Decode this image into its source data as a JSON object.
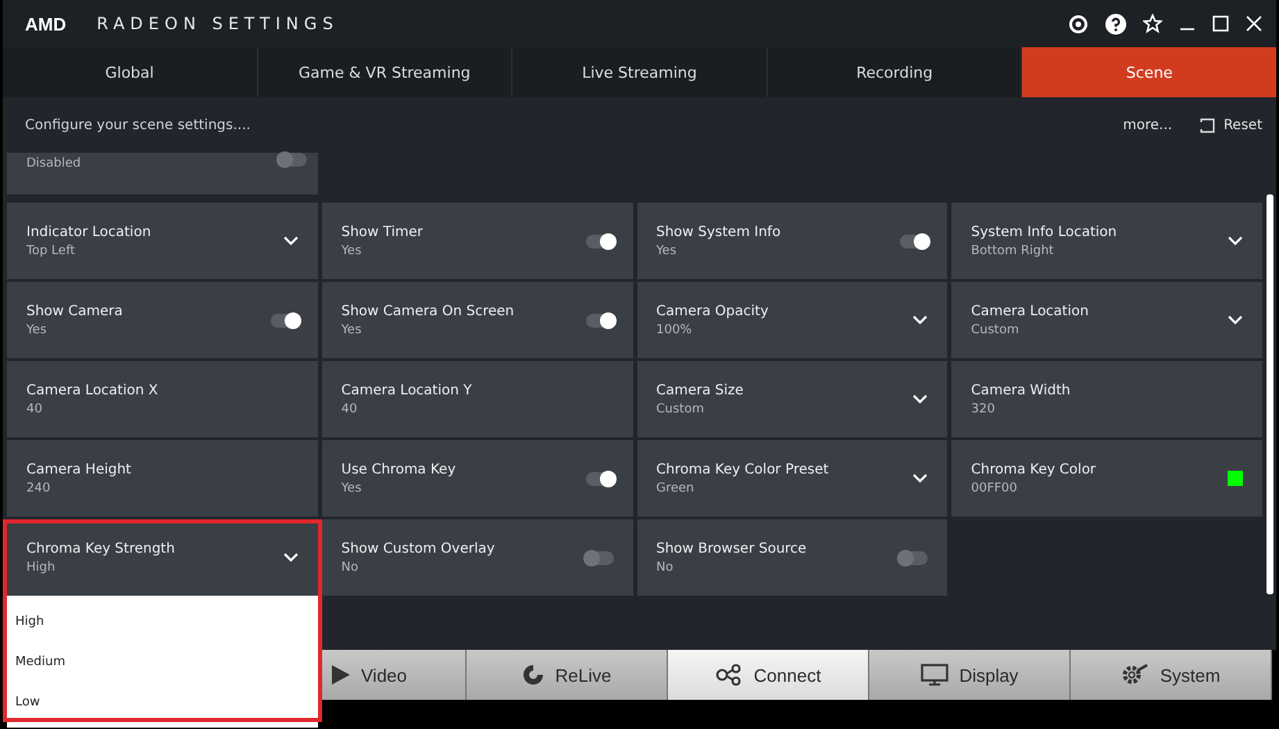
{
  "window": {
    "logo": "AMD",
    "title": "RADEON SETTINGS"
  },
  "tabs": [
    {
      "label": "Global",
      "selected": false
    },
    {
      "label": "Game & VR Streaming",
      "selected": false
    },
    {
      "label": "Live Streaming",
      "selected": false
    },
    {
      "label": "Recording",
      "selected": false
    },
    {
      "label": "Scene",
      "selected": true
    }
  ],
  "header": {
    "text": "Configure your scene settings....",
    "more": "more...",
    "reset": "Reset"
  },
  "partial_tile": {
    "kind": "toggle",
    "value": "Disabled",
    "on": false
  },
  "tiles": [
    {
      "kind": "dropdown",
      "label": "Indicator Location",
      "value": "Top Left"
    },
    {
      "kind": "toggle",
      "label": "Show Timer",
      "value": "Yes",
      "on": true
    },
    {
      "kind": "toggle",
      "label": "Show System Info",
      "value": "Yes",
      "on": true
    },
    {
      "kind": "dropdown",
      "label": "System Info Location",
      "value": "Bottom Right"
    },
    {
      "kind": "toggle",
      "label": "Show Camera",
      "value": "Yes",
      "on": true
    },
    {
      "kind": "toggle",
      "label": "Show Camera On Screen",
      "value": "Yes",
      "on": true
    },
    {
      "kind": "dropdown",
      "label": "Camera Opacity",
      "value": "100%"
    },
    {
      "kind": "dropdown",
      "label": "Camera Location",
      "value": "Custom"
    },
    {
      "kind": "text",
      "label": "Camera Location X",
      "value": "40"
    },
    {
      "kind": "text",
      "label": "Camera Location Y",
      "value": "40"
    },
    {
      "kind": "dropdown",
      "label": "Camera Size",
      "value": "Custom"
    },
    {
      "kind": "text",
      "label": "Camera Width",
      "value": "320"
    },
    {
      "kind": "text",
      "label": "Camera Height",
      "value": "240"
    },
    {
      "kind": "toggle",
      "label": "Use Chroma Key",
      "value": "Yes",
      "on": true
    },
    {
      "kind": "dropdown",
      "label": "Chroma Key Color Preset",
      "value": "Green"
    },
    {
      "kind": "color",
      "label": "Chroma Key Color",
      "value": "00FF00",
      "color": "#00ff00"
    },
    {
      "kind": "dropdown",
      "label": "Chroma Key Strength",
      "value": "High",
      "expanded": true,
      "highlighted": true,
      "options": [
        "High",
        "Medium",
        "Low"
      ]
    },
    {
      "kind": "toggle",
      "label": "Show Custom Overlay",
      "value": "No",
      "on": false
    },
    {
      "kind": "toggle",
      "label": "Show Browser Source",
      "value": "No",
      "on": false
    }
  ],
  "nav": [
    {
      "kind": "video",
      "label": "Video",
      "selected": false
    },
    {
      "kind": "relive",
      "label": "ReLive",
      "selected": false
    },
    {
      "kind": "connect",
      "label": "Connect",
      "selected": true
    },
    {
      "kind": "display",
      "label": "Display",
      "selected": false
    },
    {
      "kind": "system",
      "label": "System",
      "selected": false
    }
  ]
}
